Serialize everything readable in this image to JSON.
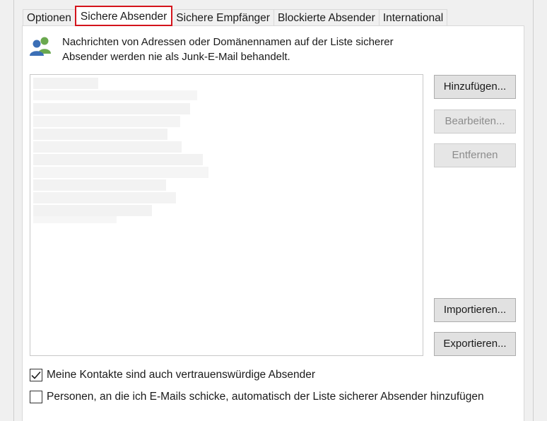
{
  "tabs": [
    {
      "label": "Optionen",
      "active": false
    },
    {
      "label": "Sichere Absender",
      "active": true
    },
    {
      "label": "Sichere Empfänger",
      "active": false
    },
    {
      "label": "Blockierte Absender",
      "active": false
    },
    {
      "label": "International",
      "active": false
    }
  ],
  "info": {
    "icon": "contacts-icon",
    "line1": "Nachrichten von Adressen oder Domänennamen auf der Liste sicherer",
    "line2": "Absender werden nie als Junk-E-Mail behandelt."
  },
  "buttons": {
    "add": "Hinzufügen...",
    "edit": "Bearbeiten...",
    "remove": "Entfernen",
    "import": "Importieren...",
    "export": "Exportieren..."
  },
  "checkboxes": {
    "trust_contacts": {
      "label": "Meine Kontakte sind auch vertrauenswürdige Absender",
      "checked": true
    },
    "auto_add": {
      "label": "Personen, an die ich E-Mails schicke, automatisch der Liste sicherer Absender hinzufügen",
      "checked": false
    }
  },
  "colors": {
    "highlight": "#d4141c",
    "icon_blue": "#3b6fb6",
    "icon_green": "#6aa84f"
  }
}
